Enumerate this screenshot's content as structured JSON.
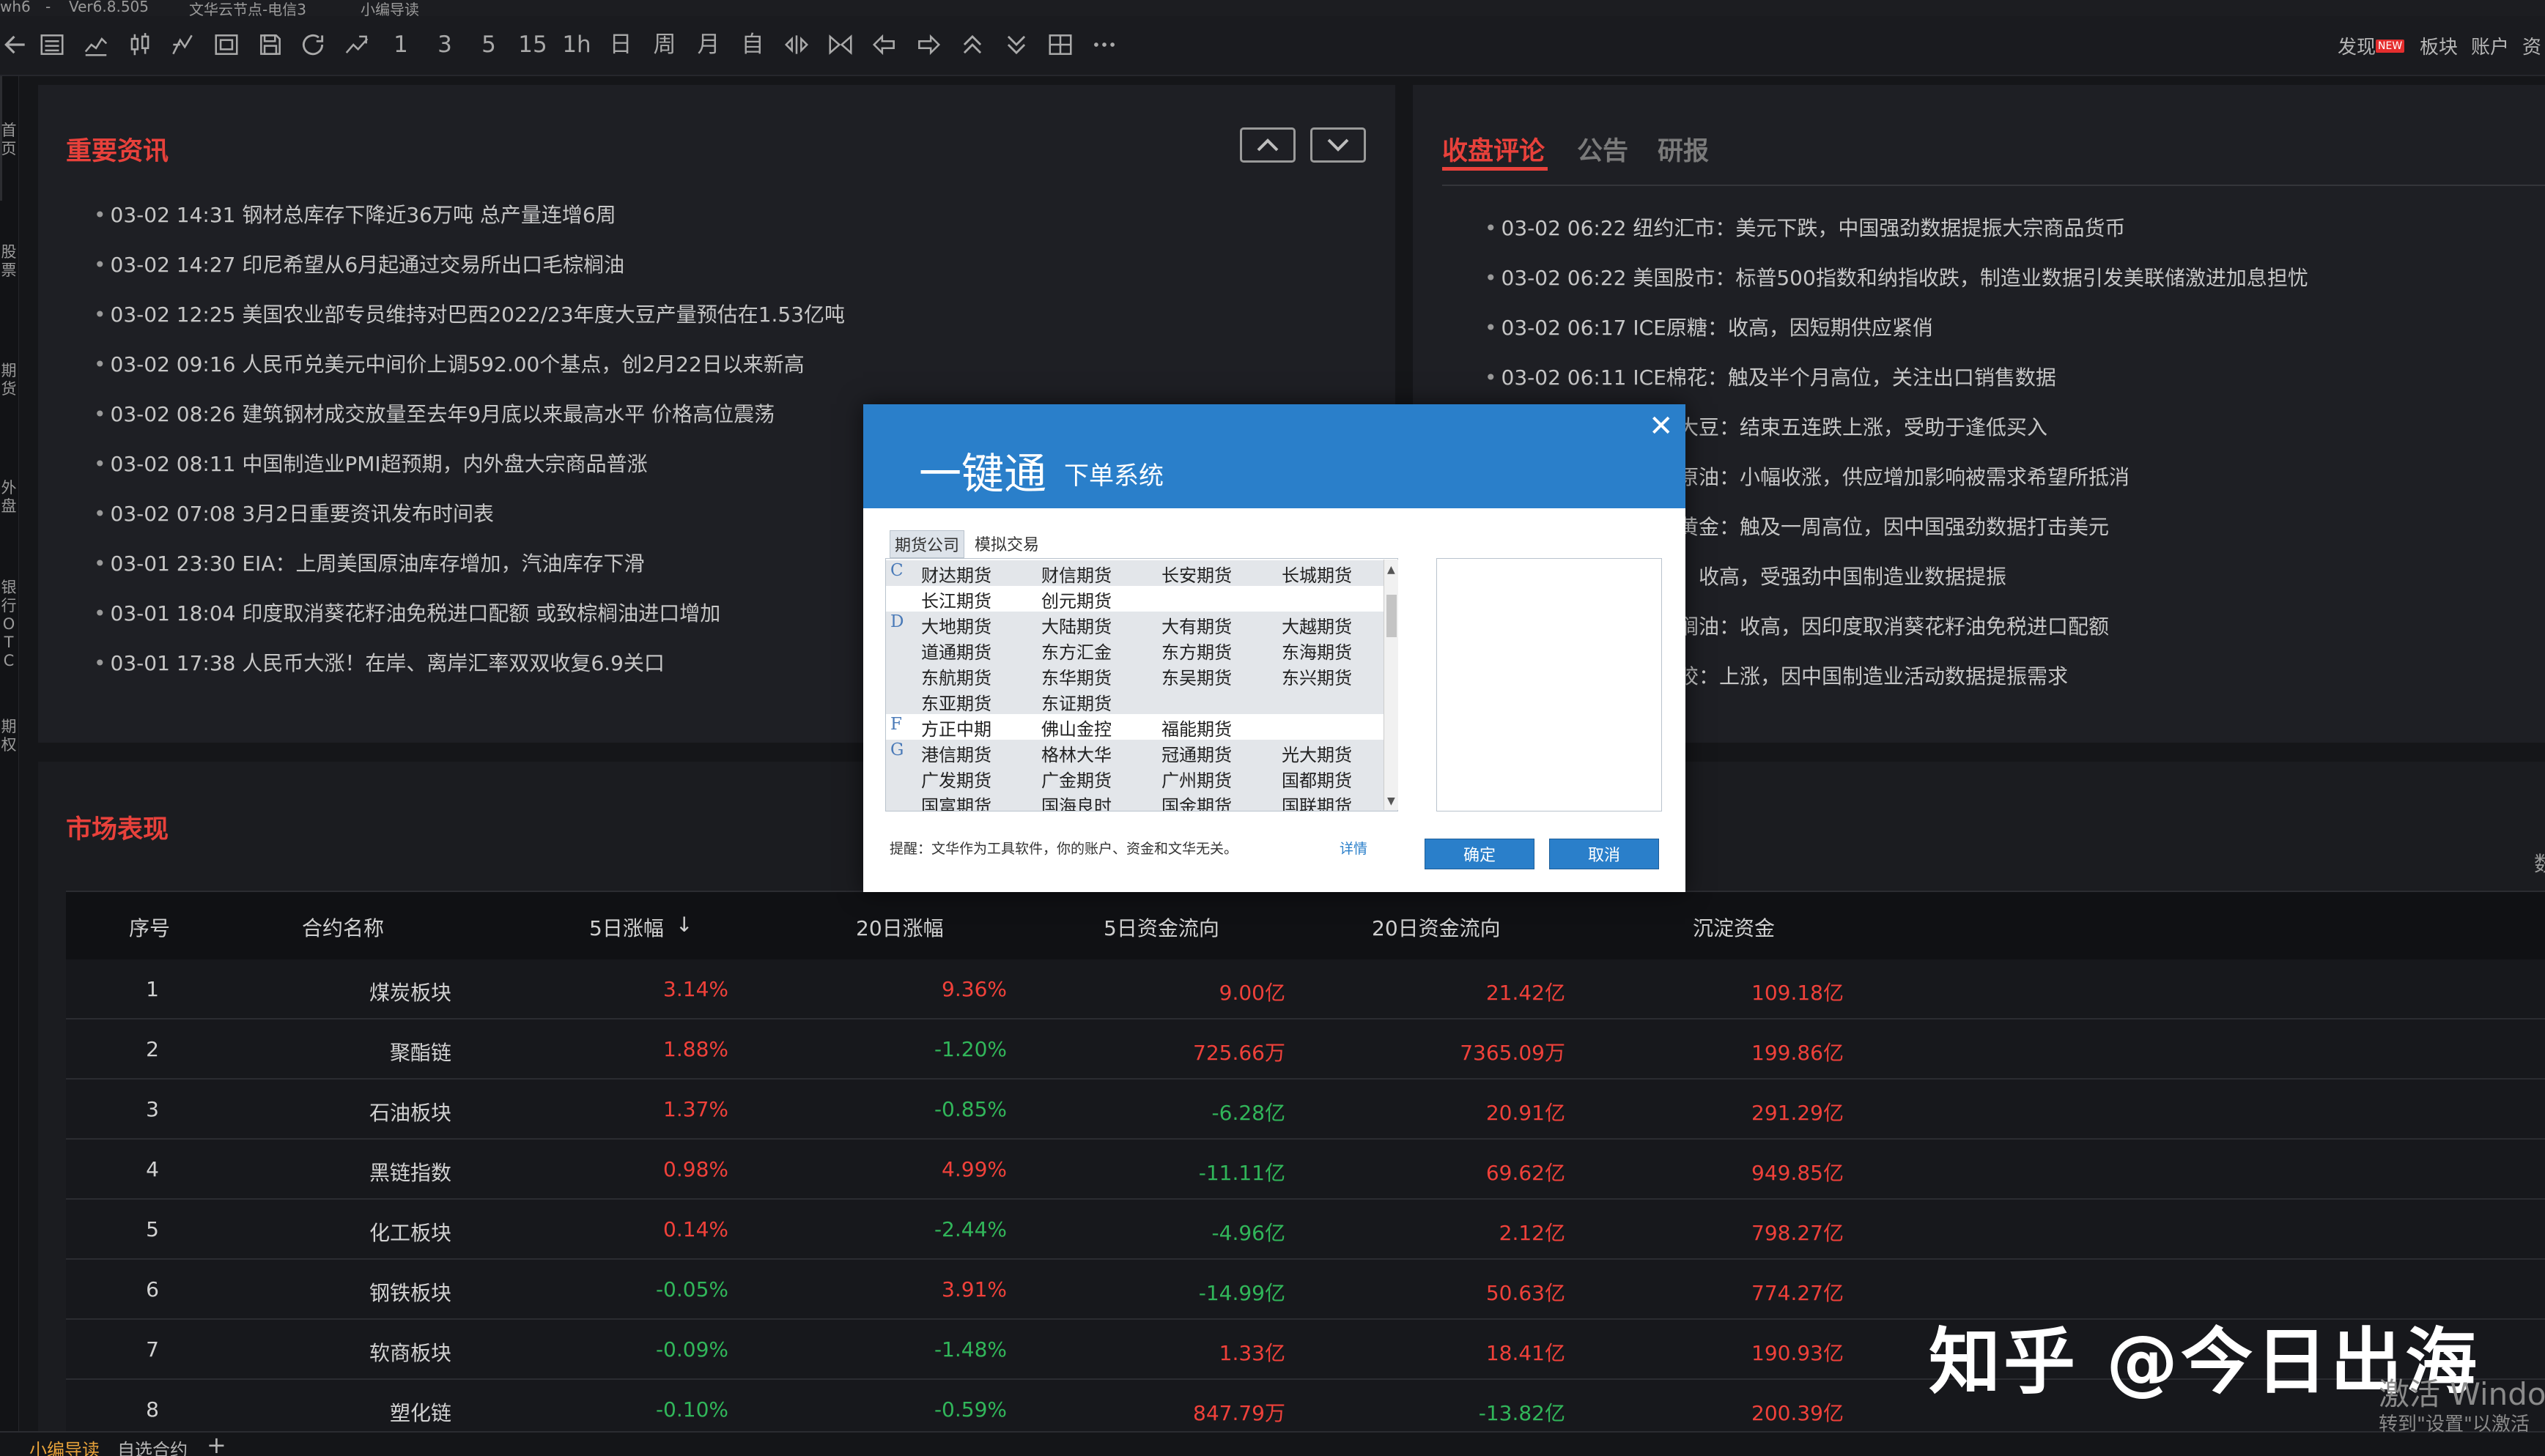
{
  "titlebar": {
    "app": "wh6",
    "sep": "-",
    "version": "Ver6.8.505",
    "node": "文华云节点-电信3",
    "guide": "小编导读"
  },
  "toolbar": {
    "text_buttons": [
      "1",
      "3",
      "5",
      "15",
      "1h",
      "日",
      "周",
      "月",
      "自"
    ],
    "right_links": {
      "discover": "发现",
      "new_badge": "NEW",
      "sector": "板块",
      "account": "账户",
      "info": "资"
    }
  },
  "leftnav": {
    "items": [
      "首页",
      "股票",
      "期货",
      "外盘",
      "银行OTC",
      "期权"
    ]
  },
  "news": {
    "title": "重要资讯",
    "items": [
      "03-02 14:31 钢材总库存下降近36万吨 总产量连增6周",
      "03-02 14:27 印尼希望从6月起通过交易所出口毛棕榈油",
      "03-02 12:25 美国农业部专员维持对巴西2022/23年度大豆产量预估在1.53亿吨",
      "03-02 09:16 人民币兑美元中间价上调592.00个基点，创2月22日以来新高",
      "03-02 08:26 建筑钢材成交放量至去年9月底以来最高水平 价格高位震荡",
      "03-02 08:11 中国制造业PMI超预期，内外盘大宗商品普涨",
      "03-02 07:08 3月2日重要资讯发布时间表",
      "03-01 23:30 EIA：上周美国原油库存增加，汽油库存下滑",
      "03-01 18:04 印度取消葵花籽油免税进口配额 或致棕榈油进口增加",
      "03-01 17:38 人民币大涨！在岸、离岸汇率双双收复6.9关口"
    ]
  },
  "comments": {
    "tabs": [
      "收盘评论",
      "公告",
      "研报"
    ],
    "items": [
      "03-02 06:22 纽约汇市：美元下跌，中国强劲数据提振大宗商品货币",
      "03-02 06:22 美国股市：标普500指数和纳指收跌，制造业数据引发美联储激进加息担忧",
      "03-02 06:17 ICE原糖：收高，因短期供应紧俏",
      "03-02 06:11 ICE棉花：触及半个月高位，关注出口销售数据",
      "大豆：结束五连跌上涨，受助于逢低买入",
      "原油：小幅收涨，供应增加影响被需求希望所抵消",
      "黄金：触及一周高位，因中国强劲数据打击美元",
      "收高，受强劲中国制造业数据提振",
      "榈油：收高，因印度取消葵花籽油免税进口配额",
      "胶：上涨，因中国制造业活动数据提振需求"
    ]
  },
  "market": {
    "title": "市场表现",
    "side_label": "数",
    "headers": [
      "序号",
      "合约名称",
      "5日涨幅",
      "20日涨幅",
      "5日资金流向",
      "20日资金流向",
      "沉淀资金"
    ],
    "sort_arrow": "↓",
    "rows": [
      {
        "no": "1",
        "name": "煤炭板块",
        "d5": "3.14%",
        "d20": "9.36%",
        "f5": "9.00亿",
        "f20": "21.42亿",
        "cap": "109.18亿",
        "c": [
          "red",
          "red",
          "red",
          "red",
          "red"
        ]
      },
      {
        "no": "2",
        "name": "聚酯链",
        "d5": "1.88%",
        "d20": "-1.20%",
        "f5": "725.66万",
        "f20": "7365.09万",
        "cap": "199.86亿",
        "c": [
          "red",
          "green",
          "red",
          "red",
          "red"
        ]
      },
      {
        "no": "3",
        "name": "石油板块",
        "d5": "1.37%",
        "d20": "-0.85%",
        "f5": "-6.28亿",
        "f20": "20.91亿",
        "cap": "291.29亿",
        "c": [
          "red",
          "green",
          "green",
          "red",
          "red"
        ]
      },
      {
        "no": "4",
        "name": "黑链指数",
        "d5": "0.98%",
        "d20": "4.99%",
        "f5": "-11.11亿",
        "f20": "69.62亿",
        "cap": "949.85亿",
        "c": [
          "red",
          "red",
          "green",
          "red",
          "red"
        ]
      },
      {
        "no": "5",
        "name": "化工板块",
        "d5": "0.14%",
        "d20": "-2.44%",
        "f5": "-4.96亿",
        "f20": "2.12亿",
        "cap": "798.27亿",
        "c": [
          "red",
          "green",
          "green",
          "red",
          "red"
        ]
      },
      {
        "no": "6",
        "name": "钢铁板块",
        "d5": "-0.05%",
        "d20": "3.91%",
        "f5": "-14.99亿",
        "f20": "50.63亿",
        "cap": "774.27亿",
        "c": [
          "green",
          "red",
          "green",
          "red",
          "red"
        ]
      },
      {
        "no": "7",
        "name": "软商板块",
        "d5": "-0.09%",
        "d20": "-1.48%",
        "f5": "1.33亿",
        "f20": "18.41亿",
        "cap": "190.93亿",
        "c": [
          "green",
          "green",
          "red",
          "red",
          "red"
        ]
      },
      {
        "no": "8",
        "name": "塑化链",
        "d5": "-0.10%",
        "d20": "-0.59%",
        "f5": "847.79万",
        "f20": "-13.82亿",
        "cap": "200.39亿",
        "c": [
          "green",
          "green",
          "red",
          "green",
          "red"
        ]
      }
    ]
  },
  "bottom_tabs": [
    "小编导读",
    "自选合约",
    "+"
  ],
  "dialog": {
    "title": "一键通",
    "subtitle": "下单系统",
    "close": "✕",
    "tabs": [
      "期货公司",
      "模拟交易"
    ],
    "companies": [
      {
        "letter": "C",
        "names": [
          "财达期货",
          "财信期货",
          "长安期货",
          "长城期货"
        ]
      },
      {
        "letter": "",
        "names": [
          "长江期货",
          "创元期货",
          "",
          ""
        ]
      },
      {
        "letter": "D",
        "names": [
          "大地期货",
          "大陆期货",
          "大有期货",
          "大越期货"
        ]
      },
      {
        "letter": "",
        "names": [
          "道通期货",
          "东方汇金",
          "东方期货",
          "东海期货"
        ]
      },
      {
        "letter": "",
        "names": [
          "东航期货",
          "东华期货",
          "东吴期货",
          "东兴期货"
        ]
      },
      {
        "letter": "",
        "names": [
          "东亚期货",
          "东证期货",
          "",
          ""
        ]
      },
      {
        "letter": "F",
        "names": [
          "方正中期",
          "佛山金控",
          "福能期货",
          ""
        ]
      },
      {
        "letter": "G",
        "names": [
          "港信期货",
          "格林大华",
          "冠通期货",
          "光大期货"
        ]
      },
      {
        "letter": "",
        "names": [
          "广发期货",
          "广金期货",
          "广州期货",
          "国都期货"
        ]
      },
      {
        "letter": "",
        "names": [
          "国富期货",
          "国海良时",
          "国金期货",
          "国联期货"
        ]
      }
    ],
    "note": "提醒：文华作为工具软件，你的账户、资金和文华无关。",
    "detail": "详情",
    "ok": "确定",
    "cancel": "取消"
  },
  "watermark": "知乎 @今日出海",
  "activation": {
    "line1": "激活 Windov",
    "line2": "转到\"设置\"以激活"
  }
}
